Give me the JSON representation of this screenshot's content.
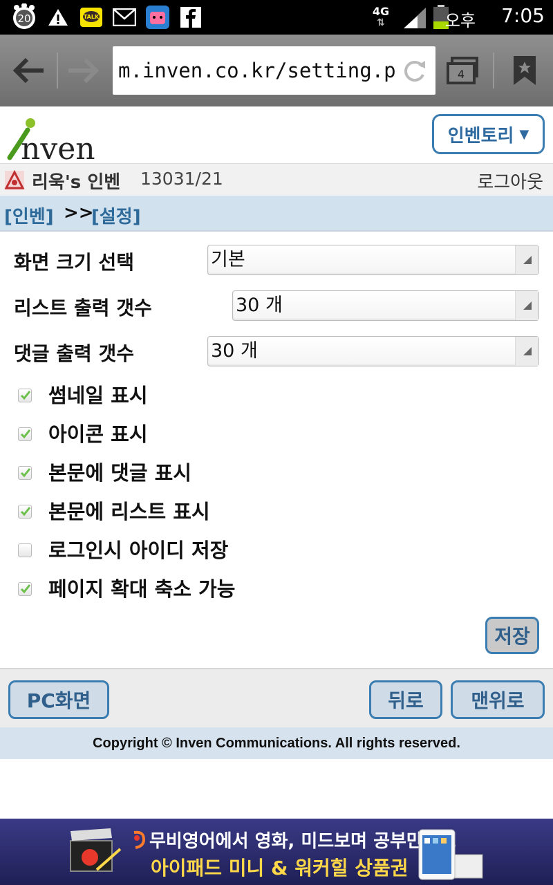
{
  "statusbar": {
    "notification_count": "20",
    "talk_label": "TALK",
    "network": "4G",
    "ampm": "오후",
    "time": "7:05"
  },
  "browser": {
    "url": "m.inven.co.kr/setting.ph",
    "tab_count": "4"
  },
  "header": {
    "logo_text": "nven",
    "inventory_label": "인벤토리",
    "inventory_arrow": "▼"
  },
  "user": {
    "name": "리욱's 인벤",
    "points": "13031/21",
    "logout_label": "로그아웃"
  },
  "breadcrumb": {
    "home": "[인벤]",
    "separator": ">>",
    "current": "[설정]"
  },
  "settings": {
    "screen_size": {
      "label": "화면 크기 선택",
      "value": "기본"
    },
    "list_count": {
      "label": "리스트 출력 갯수",
      "value": "30 개"
    },
    "comment_count": {
      "label": "댓글 출력 갯수",
      "value": "30 개"
    },
    "options": [
      {
        "label": "썸네일 표시",
        "checked": true
      },
      {
        "label": "아이콘 표시",
        "checked": true
      },
      {
        "label": "본문에 댓글 표시",
        "checked": true
      },
      {
        "label": "본문에 리스트 표시",
        "checked": true
      },
      {
        "label": "로그인시 아이디 저장",
        "checked": false
      },
      {
        "label": "페이지 확대 축소 가능",
        "checked": true
      }
    ],
    "save_label": "저장"
  },
  "bottom": {
    "pc_label": "PC화면",
    "back_label": "뒤로",
    "top_label": "맨위로"
  },
  "footer": {
    "copyright": "Copyright © Inven Communications. All rights reserved."
  },
  "ad": {
    "line1": "무비영어에서 영화, 미드보며 공부만해도",
    "line2": "아이패드 미니 & 워커힐 상품권"
  },
  "colors": {
    "accent": "#3b7db1",
    "crumb_bg": "#d2e1ee",
    "check": "#6cc04a"
  }
}
